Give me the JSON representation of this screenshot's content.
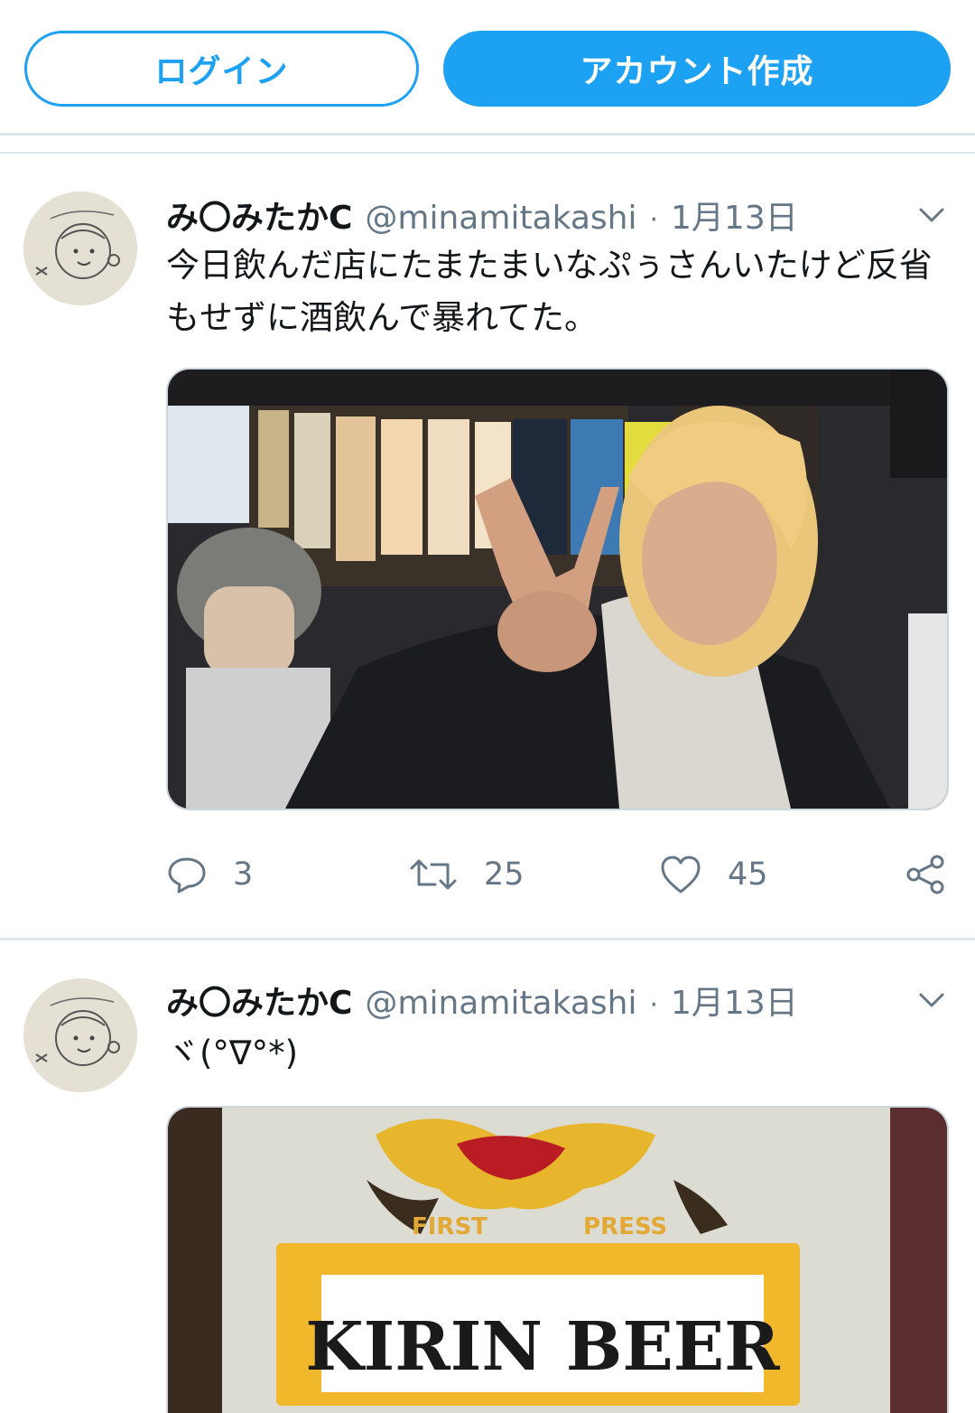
{
  "topbar": {
    "login_label": "ログイン",
    "signup_label": "アカウント作成",
    "accent_color": "#1da1f2"
  },
  "tweets": [
    {
      "name": "み〇みたかC",
      "handle": "@minamitakashi",
      "separator": "·",
      "date": "1月13日",
      "text": "今日飲んだ店にたまたまいなぷぅさんいたけど反省もせずに酒飲んで暴れてた。",
      "media": "photo",
      "replies": "3",
      "retweets": "25",
      "likes": "45"
    },
    {
      "name": "み〇みたかC",
      "handle": "@minamitakashi",
      "separator": "·",
      "date": "1月13日",
      "text": "ヾ(°∇°*)",
      "media": "photo",
      "media_text": {
        "brand": "KIRIN BEER",
        "sub_left": "FIRST",
        "sub_right": "PRESS"
      }
    }
  ],
  "icons": [
    "chevron-down-icon",
    "reply-icon",
    "retweet-icon",
    "like-icon",
    "share-icon"
  ]
}
